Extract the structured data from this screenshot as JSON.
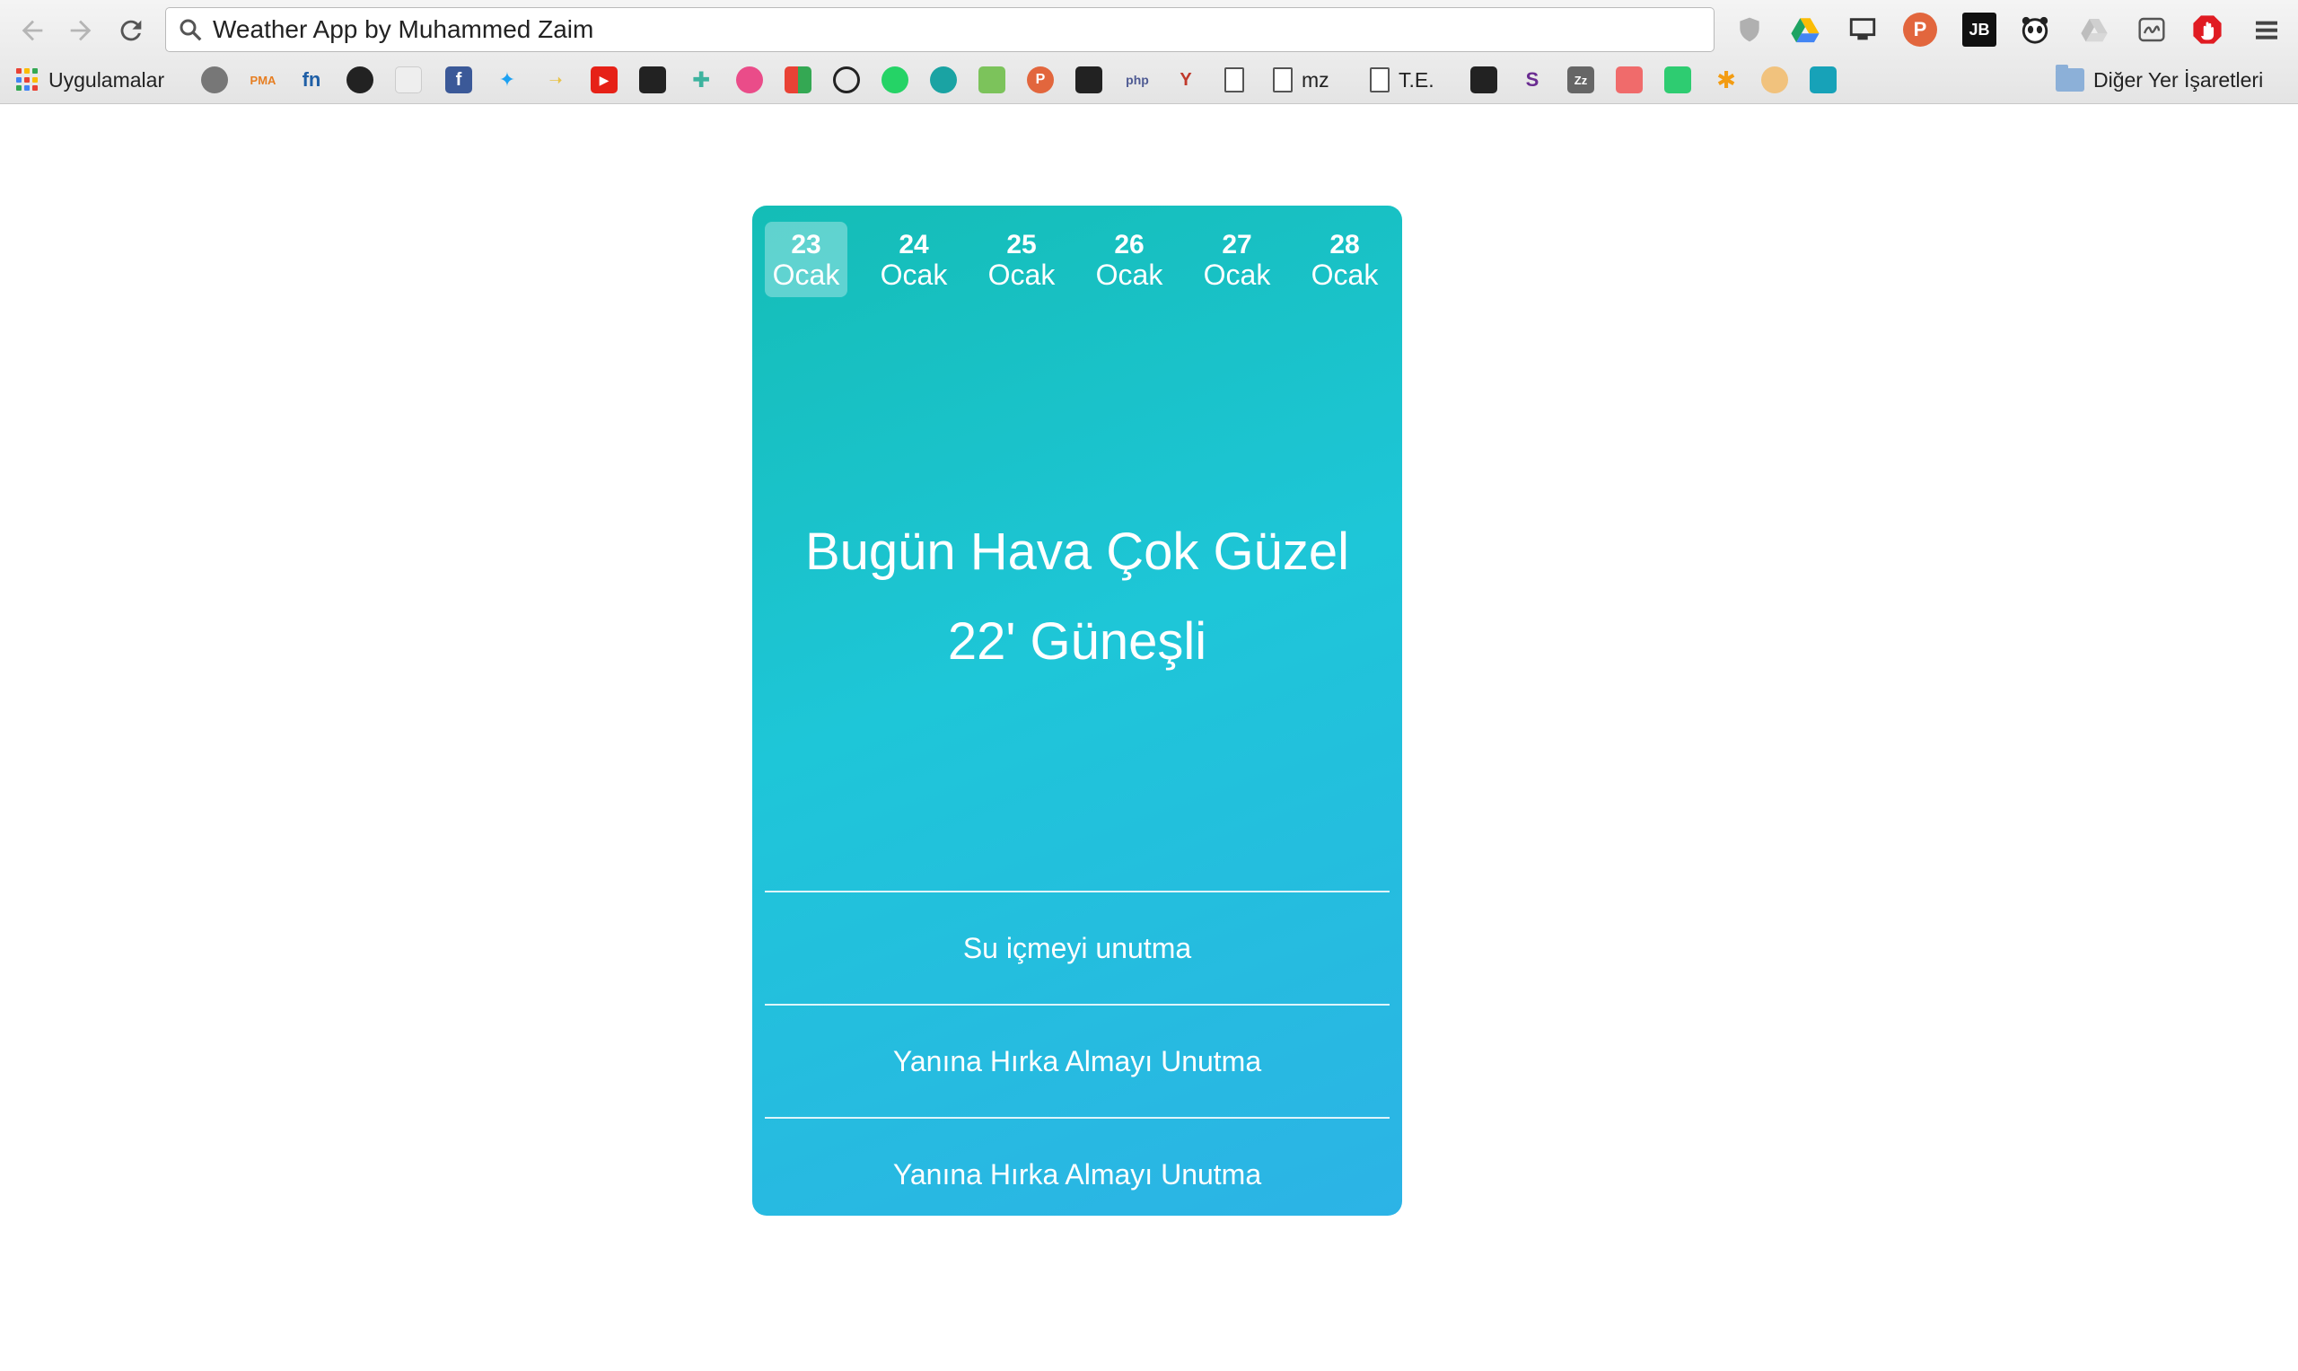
{
  "browser": {
    "url": "Weather App by Muhammed Zaim",
    "bookmarks": {
      "apps_label": "Uygulamalar",
      "mz_label": "mz",
      "te_label": "T.E.",
      "other_label": "Diğer Yer İşaretleri"
    }
  },
  "weather": {
    "days": [
      {
        "day": "23",
        "month": "Ocak",
        "active": true
      },
      {
        "day": "24",
        "month": "Ocak",
        "active": false
      },
      {
        "day": "25",
        "month": "Ocak",
        "active": false
      },
      {
        "day": "26",
        "month": "Ocak",
        "active": false
      },
      {
        "day": "27",
        "month": "Ocak",
        "active": false
      },
      {
        "day": "28",
        "month": "Ocak",
        "active": false
      }
    ],
    "headline_line1": "Bugün Hava Çok Güzel",
    "headline_line2": "22' Güneşli",
    "reminders": [
      "Su içmeyi unutma",
      "Yanına Hırka Almayı Unutma",
      "Yanına Hırka Almayı Unutma"
    ]
  },
  "colors": {
    "card_gradient_start": "#14bdb6",
    "card_gradient_end": "#2cb3e6",
    "text": "#ffffff"
  }
}
